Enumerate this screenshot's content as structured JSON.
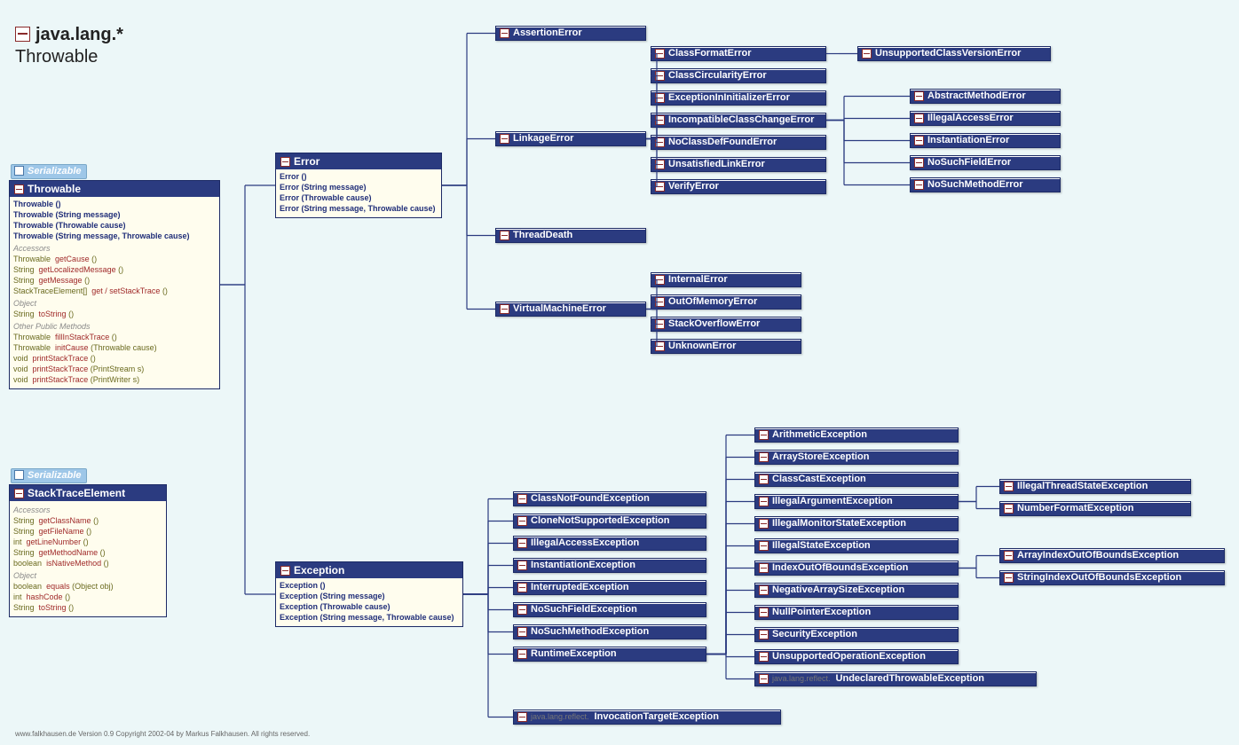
{
  "title_pkg": "java.lang.*",
  "title_class": "Throwable",
  "serializable": "Serializable",
  "footer": "www.falkhausen.de Version 0.9 Copyright 2002-04 by Markus Falkhausen. All rights reserved.",
  "throwable": {
    "name": "Throwable",
    "ctors": [
      "Throwable ()",
      "Throwable (String message)",
      "Throwable (Throwable cause)",
      "Throwable (String message, Throwable cause)"
    ],
    "sect_accessors": "Accessors",
    "accessors": [
      {
        "ret": "Throwable",
        "name": "getCause",
        "sig": "()"
      },
      {
        "ret": "String",
        "name": "getLocalizedMessage",
        "sig": "()"
      },
      {
        "ret": "String",
        "name": "getMessage",
        "sig": "()"
      },
      {
        "ret": "StackTraceElement[]",
        "name": "get / setStackTrace",
        "sig": "()"
      }
    ],
    "sect_object": "Object",
    "object": [
      {
        "ret": "String",
        "name": "toString",
        "sig": "()"
      }
    ],
    "sect_other": "Other Public Methods",
    "other": [
      {
        "ret": "Throwable",
        "name": "fillInStackTrace",
        "sig": "()"
      },
      {
        "ret": "Throwable",
        "name": "initCause",
        "sig": "(Throwable cause)"
      },
      {
        "ret": "void",
        "name": "printStackTrace",
        "sig": "()"
      },
      {
        "ret": "void",
        "name": "printStackTrace",
        "sig": "(PrintStream s)"
      },
      {
        "ret": "void",
        "name": "printStackTrace",
        "sig": "(PrintWriter s)"
      }
    ]
  },
  "stacktrace": {
    "name": "StackTraceElement",
    "sect_accessors": "Accessors",
    "accessors": [
      {
        "ret": "String",
        "name": "getClassName",
        "sig": "()"
      },
      {
        "ret": "String",
        "name": "getFileName",
        "sig": "()"
      },
      {
        "ret": "int",
        "name": "getLineNumber",
        "sig": "()"
      },
      {
        "ret": "String",
        "name": "getMethodName",
        "sig": "()"
      },
      {
        "ret": "boolean",
        "name": "isNativeMethod",
        "sig": "()"
      }
    ],
    "sect_object": "Object",
    "object": [
      {
        "ret": "boolean",
        "name": "equals",
        "sig": "(Object obj)"
      },
      {
        "ret": "int",
        "name": "hashCode",
        "sig": "()"
      },
      {
        "ret": "String",
        "name": "toString",
        "sig": "()"
      }
    ]
  },
  "error": {
    "name": "Error",
    "ctors": [
      "Error ()",
      "Error (String message)",
      "Error (Throwable cause)",
      "Error (String message, Throwable cause)"
    ]
  },
  "exception": {
    "name": "Exception",
    "ctors": [
      "Exception ()",
      "Exception (String message)",
      "Exception (Throwable cause)",
      "Exception (String message, Throwable cause)"
    ]
  },
  "error_children": [
    "AssertionError",
    "LinkageError",
    "ThreadDeath",
    "VirtualMachineError"
  ],
  "linkage_children": [
    "ClassFormatError",
    "ClassCircularityError",
    "ExceptionInInitializerError",
    "IncompatibleClassChangeError",
    "NoClassDefFoundError",
    "UnsatisfiedLinkError",
    "VerifyError"
  ],
  "classformat_children": [
    "UnsupportedClassVersionError"
  ],
  "iccerror_children": [
    "AbstractMethodError",
    "IllegalAccessError",
    "InstantiationError",
    "NoSuchFieldError",
    "NoSuchMethodError"
  ],
  "vme_children": [
    "InternalError",
    "OutOfMemoryError",
    "StackOverflowError",
    "UnknownError"
  ],
  "exception_children": [
    "ClassNotFoundException",
    "CloneNotSupportedException",
    "IllegalAccessException",
    "InstantiationException",
    "InterruptedException",
    "NoSuchFieldException",
    "NoSuchMethodException",
    "RuntimeException"
  ],
  "invocation": {
    "pkg": "java.lang.reflect.",
    "name": "InvocationTargetException"
  },
  "runtime_children": [
    "ArithmeticException",
    "ArrayStoreException",
    "ClassCastException",
    "IllegalArgumentException",
    "IllegalMonitorStateException",
    "IllegalStateException",
    "IndexOutOfBoundsException",
    "NegativeArraySizeException",
    "NullPointerException",
    "SecurityException",
    "UnsupportedOperationException"
  ],
  "undeclared": {
    "pkg": "java.lang.reflect.",
    "name": "UndeclaredThrowableException"
  },
  "iae_children": [
    "IllegalThreadStateException",
    "NumberFormatException"
  ],
  "ioobe_children": [
    "ArrayIndexOutOfBoundsException",
    "StringIndexOutOfBoundsException"
  ]
}
